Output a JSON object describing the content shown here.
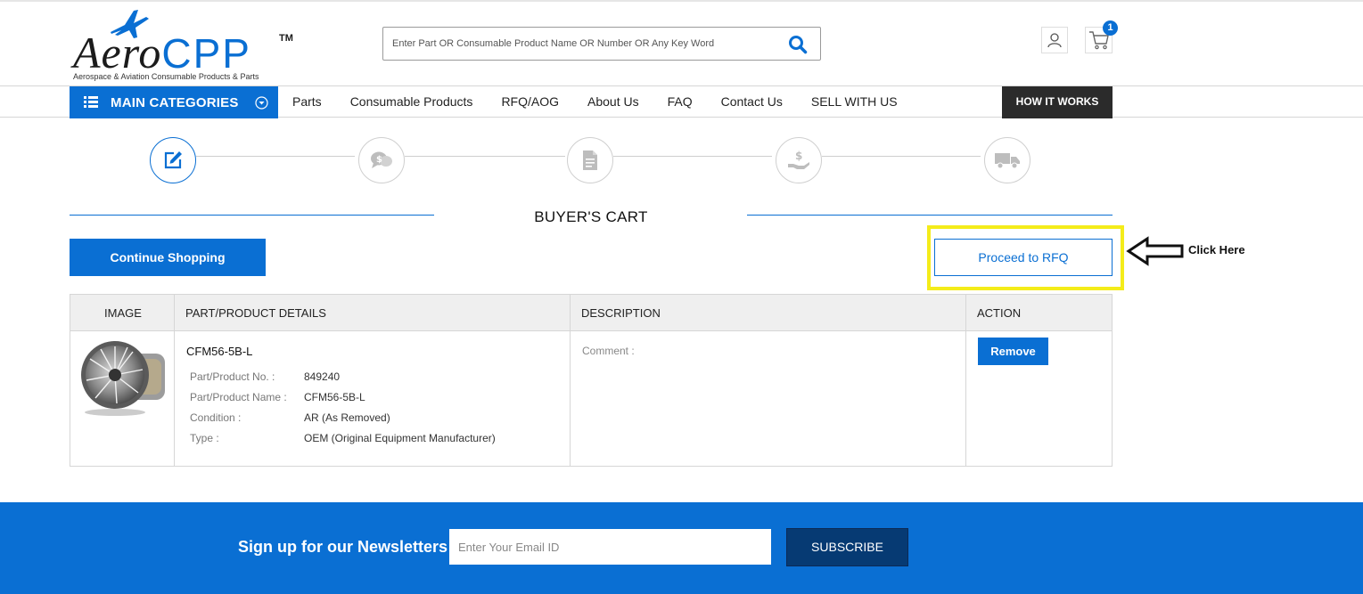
{
  "brand": {
    "logo_aero": "Aero",
    "logo_cpp": "CPP",
    "logo_tm": "TM",
    "tagline": "Aerospace & Aviation Consumable Products & Parts",
    "accent_color": "#0a6fd3"
  },
  "header": {
    "search_placeholder": "Enter Part OR Consumable Product Name OR Number OR Any Key Word",
    "cart_count": "1"
  },
  "nav": {
    "main_categories": "MAIN CATEGORIES",
    "links": [
      "Parts",
      "Consumable Products",
      "RFQ/AOG",
      "About Us",
      "FAQ",
      "Contact Us",
      "SELL WITH US"
    ],
    "how_it_works": "HOW IT WORKS"
  },
  "steps": {
    "icons": [
      "edit-icon",
      "chat-dollar-icon",
      "document-icon",
      "hand-dollar-icon",
      "truck-icon"
    ],
    "active_index": 0
  },
  "cart": {
    "title": "BUYER'S CART",
    "continue_shopping": "Continue Shopping",
    "proceed_rfq": "Proceed to RFQ",
    "annotation": "Click Here",
    "highlight_color": "#f4ec1a",
    "columns": [
      "IMAGE",
      "PART/PRODUCT DETAILS",
      "DESCRIPTION",
      "ACTION"
    ],
    "item": {
      "title": "CFM56-5B-L",
      "specs": [
        {
          "label": "Part/Product No. :",
          "value": "849240"
        },
        {
          "label": "Part/Product Name :",
          "value": "CFM56-5B-L"
        },
        {
          "label": "Condition :",
          "value": "AR (As Removed)"
        },
        {
          "label": "Type :",
          "value": "OEM (Original Equipment Manufacturer)"
        }
      ],
      "comment_label": "Comment :",
      "remove": "Remove"
    }
  },
  "footer": {
    "newsletter_label": "Sign up for our Newsletters",
    "email_placeholder": "Enter Your Email ID",
    "subscribe": "SUBSCRIBE"
  }
}
